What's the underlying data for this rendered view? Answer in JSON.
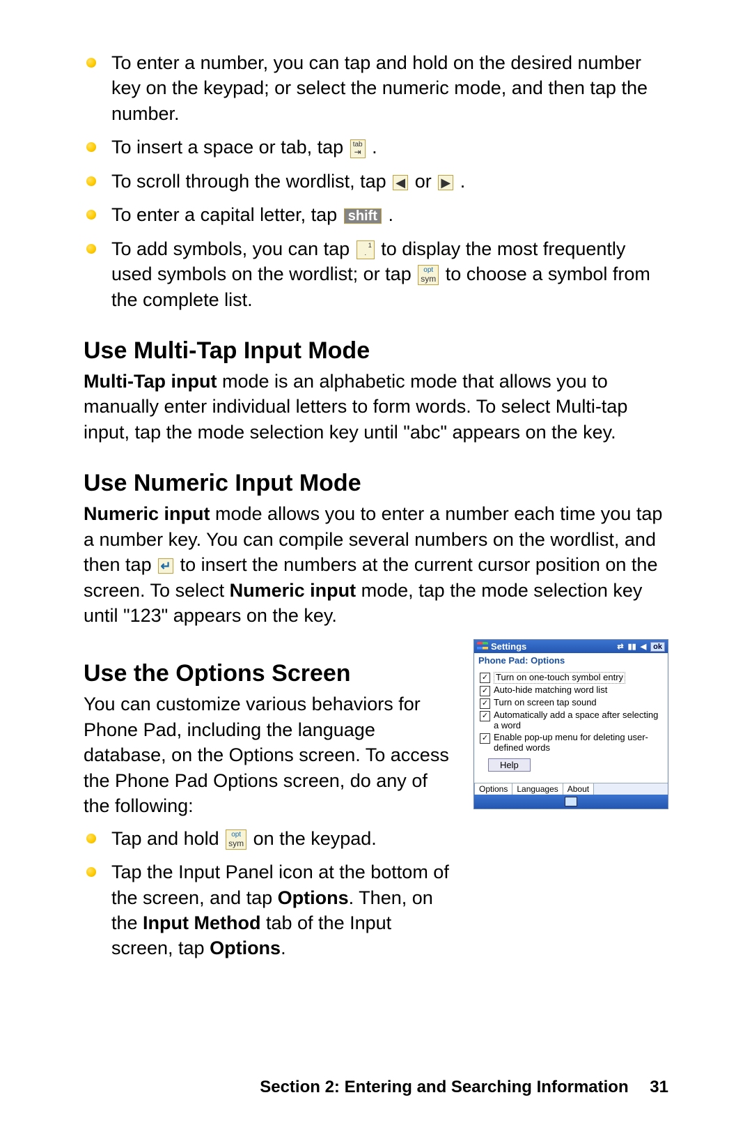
{
  "bullets_top": [
    {
      "text": "To enter a number, you can tap and hold on the desired number key on the keypad; or select the numeric mode, and then tap the number."
    },
    {
      "prefix": "To insert a space or tab, tap ",
      "key_type": "tab",
      "suffix": " ."
    },
    {
      "prefix": "To scroll through the wordlist, tap ",
      "key_type": "arrows",
      "mid": " or ",
      "suffix": " ."
    },
    {
      "prefix": "To enter a capital letter, tap ",
      "key_type": "shift",
      "key_label": "shift",
      "suffix": " ."
    },
    {
      "prefix": "To add symbols, you can tap ",
      "key_type": "dot1",
      "mid": " to display the most frequently used symbols on the wordlist; or tap ",
      "key2_type": "sym",
      "suffix": " to choose a symbol from the complete list."
    }
  ],
  "h_multi": "Use Multi-Tap Input Mode",
  "p_multi_bold": "Multi-Tap input",
  "p_multi_rest": " mode is an alphabetic mode that allows you to manually enter individual letters to form words. To select Multi-tap input, tap the mode selection key until \"abc\" appears on the key.",
  "h_numeric": "Use Numeric Input Mode",
  "p_num_bold": "Numeric input",
  "p_num_a": " mode allows you to enter a number each time you tap a number key. You can compile several numbers on the wordlist, and then tap ",
  "p_num_b": " to insert the numbers at the current cursor position on the screen. To select ",
  "p_num_bold2": "Numeric input",
  "p_num_c": " mode, tap the mode selection key until \"123\" appears on the key.",
  "h_options": "Use the Options Screen",
  "p_options": "You can customize various behaviors for Phone Pad, including the language database, on the Options screen. To access the Phone Pad Options screen, do any of the following:",
  "bullets_bottom": [
    {
      "prefix": "Tap and hold ",
      "key_type": "sym",
      "suffix": " on the keypad."
    },
    {
      "a": "Tap the Input Panel icon at the bottom of the screen, and tap ",
      "b_bold": "Options",
      "c": ". Then, on the ",
      "d_bold": "Input Method",
      "e": " tab of the Input screen, tap ",
      "f_bold": "Options",
      "g": "."
    }
  ],
  "device": {
    "title": "Settings",
    "ok": "ok",
    "subtitle": "Phone Pad: Options",
    "options": [
      "Turn on one-touch symbol entry",
      "Auto-hide matching word list",
      "Turn on screen tap sound",
      "Automatically add a space after selecting a word",
      "Enable pop-up menu for deleting user-defined words"
    ],
    "help": "Help",
    "tabs": [
      "Options",
      "Languages",
      "About"
    ]
  },
  "footer_section": "Section 2: Entering and Searching Information",
  "footer_page": "31"
}
